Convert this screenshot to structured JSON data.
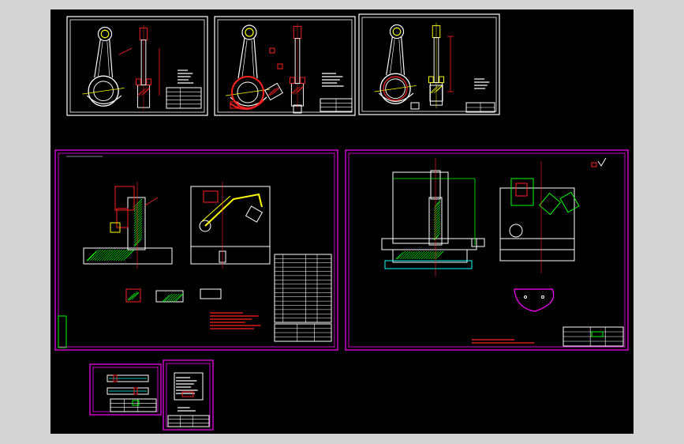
{
  "viewer": {
    "background": "#000000",
    "frame_color": "#d4d4d4"
  },
  "colors": {
    "white": "#ffffff",
    "magenta": "#ff00ff",
    "red": "#ff2020",
    "yellow": "#ffff00",
    "green": "#00ff00",
    "cyan": "#00ffff",
    "gray": "#9a9a9a"
  },
  "sheets": [
    {
      "id": "part-drawing-1",
      "border": "white",
      "content": "connecting-rod"
    },
    {
      "id": "part-drawing-2",
      "border": "white",
      "content": "connecting-rod-with-sections"
    },
    {
      "id": "part-drawing-3",
      "border": "white",
      "content": "connecting-rod-blank"
    },
    {
      "id": "fixture-assembly-1",
      "border": "magenta",
      "content": "fixture-assembly"
    },
    {
      "id": "fixture-assembly-2",
      "border": "magenta",
      "content": "fixture-assembly-2"
    },
    {
      "id": "small-sheet-1",
      "border": "magenta",
      "content": "small-part"
    },
    {
      "id": "small-sheet-2",
      "border": "magenta",
      "content": "process-card"
    }
  ]
}
